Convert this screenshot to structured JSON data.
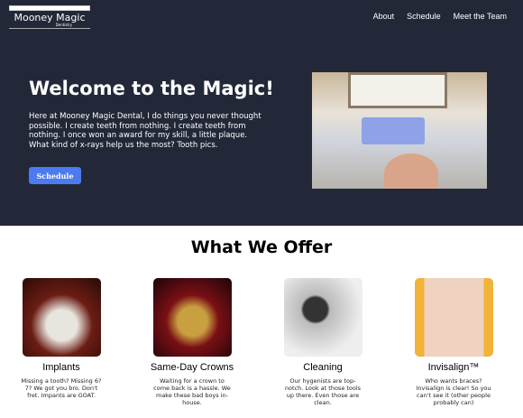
{
  "logo": {
    "name": "Mooney Magic",
    "sub": "Dentistry"
  },
  "nav": [
    "About",
    "Schedule",
    "Meet the Team"
  ],
  "hero": {
    "title": "Welcome to the Magic!",
    "text": "Here at Mooney Magic Dental, I do things you never thought possible. I create teeth from nothing. I create teeth from nothing. I once won an award for my skill, a little plaque. What kind of x-rays help us the most? Tooth pics.",
    "button": "Schedule"
  },
  "offer": {
    "title": "What We Offer",
    "cards": [
      {
        "title": "Implants",
        "text": "Missing a tooth? Missing 6? 7? We got you bro. Don't fret. Impants are GOAT.",
        "color": "#6b1d14"
      },
      {
        "title": "Same-Day Crowns",
        "text": "Waiting for a crown to come back is a hassle. We make these bad boys in-house.",
        "color": "#3a0d10"
      },
      {
        "title": "Cleaning",
        "text": "Our hygenists are top-notch. Look at those tools up there. Even those are clean.",
        "color": "#9a9a9a"
      },
      {
        "title": "Invisalign™",
        "text": "Who wants braces? Invisalign is clear! So you can't see it (other people probably can)",
        "color": "#e6a060"
      }
    ]
  }
}
